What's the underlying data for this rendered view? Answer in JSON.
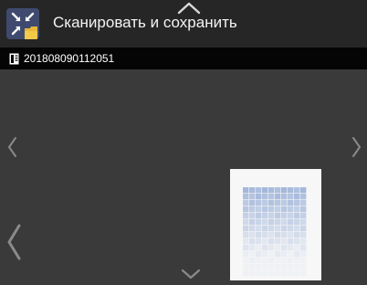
{
  "header": {
    "title": "Сканировать и сохранить",
    "app_icon": "scan-save-app-icon",
    "scroll_up_icon": "chevron-up-icon"
  },
  "file_bar": {
    "file_icon": "document-icon",
    "file_name": "201808090112051"
  },
  "navigation": {
    "prev_small_icon": "chevron-left-icon",
    "next_small_icon": "chevron-right-icon",
    "prev_large_icon": "chevron-left-large-icon",
    "scroll_down_icon": "chevron-down-icon"
  },
  "preview": {
    "thumbnail": "scanned-page-thumbnail"
  },
  "colors": {
    "header_bg": "#262626",
    "file_bar_bg": "#050505",
    "content_bg": "#3a3a3a",
    "preview_blue": "#9fb4d9"
  }
}
